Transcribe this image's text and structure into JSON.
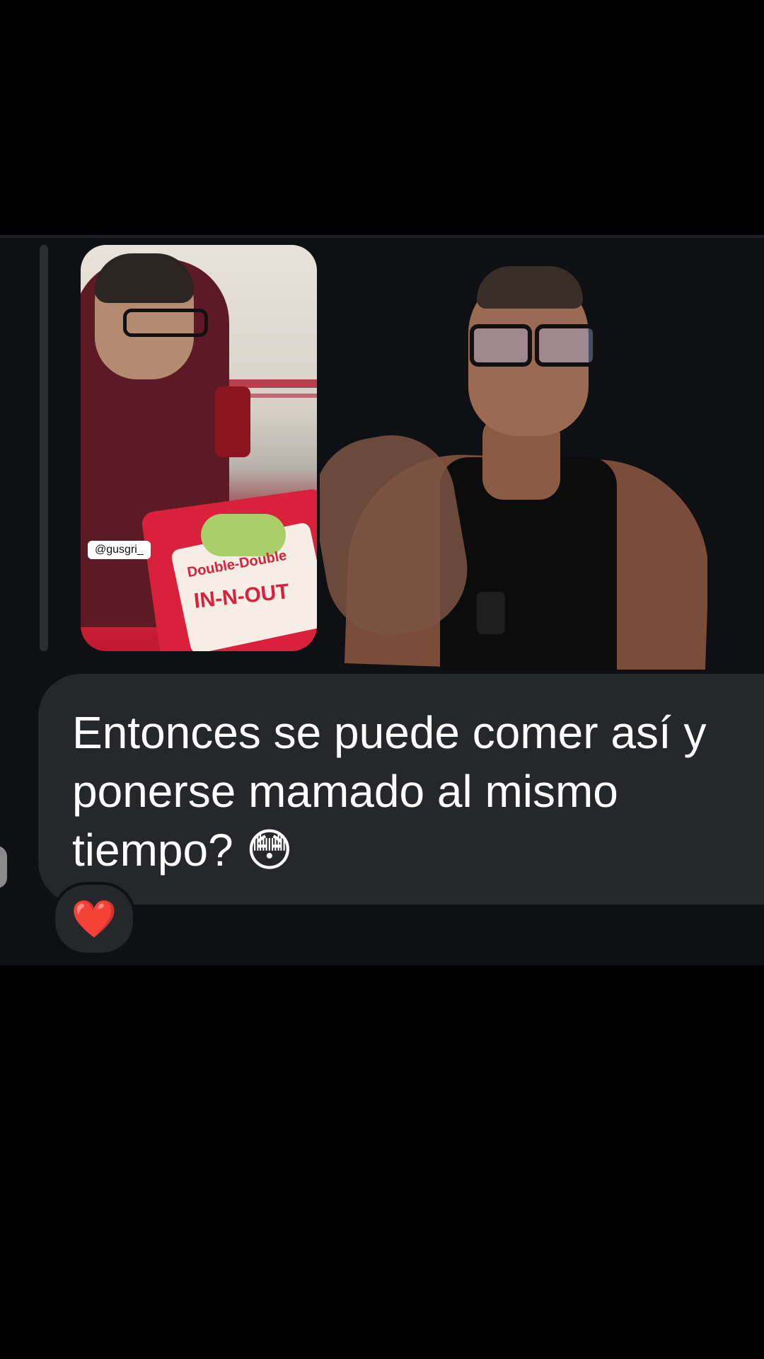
{
  "message": {
    "text": "Entonces se puede comer así y\nponerse mamado al mismo\ntiempo? 😳"
  },
  "reply_preview": {
    "handle_tag": "@gusgri_",
    "burger_label": "Double-Double",
    "brand_label": "IN-N-OUT"
  },
  "reaction": {
    "emoji": "❤️"
  },
  "colors": {
    "background": "#000000",
    "chat_panel": "#0f1013",
    "bubble": "#26272b",
    "text": "#ffffff"
  }
}
